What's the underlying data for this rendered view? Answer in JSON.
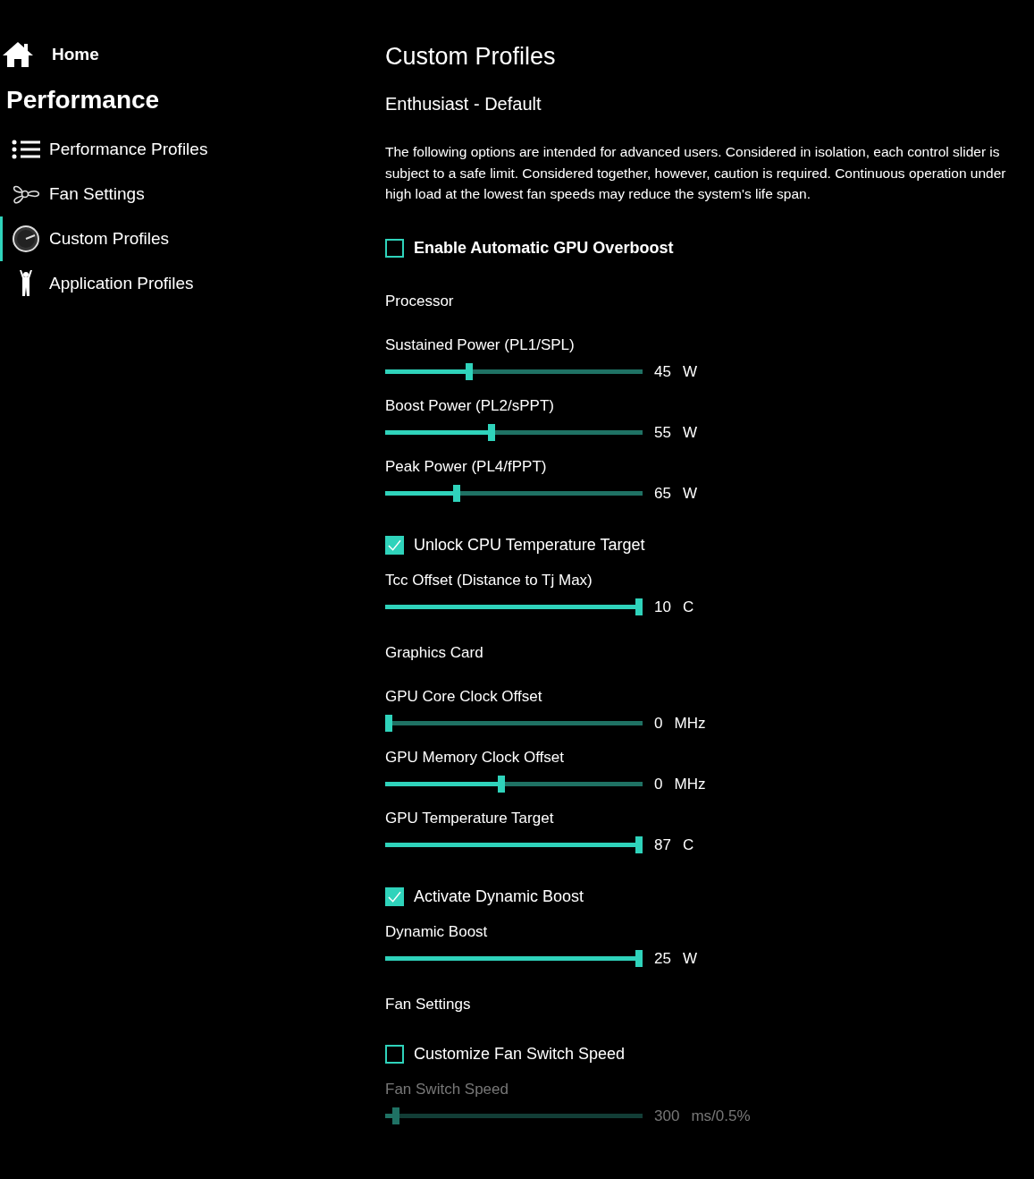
{
  "sidebar": {
    "home": "Home",
    "section": "Performance",
    "items": [
      {
        "label": "Performance Profiles",
        "selected": false
      },
      {
        "label": "Fan Settings",
        "selected": false
      },
      {
        "label": "Custom Profiles",
        "selected": true
      },
      {
        "label": "Application Profiles",
        "selected": false
      }
    ]
  },
  "main": {
    "title": "Custom Profiles",
    "subtitle": "Enthusiast - Default",
    "description": "The following options are intended for advanced users. Considered in isolation, each control slider is subject to a safe limit. Considered together, however, caution is required. Continuous operation under high load at the lowest fan speeds may reduce the system's life span.",
    "controls": [
      {
        "kind": "checkbox",
        "label": "Enable Automatic GPU Overboost",
        "checked": false,
        "bold": true
      },
      {
        "kind": "section",
        "label": "Processor"
      },
      {
        "kind": "slider",
        "label": "Sustained Power (PL1/SPL)",
        "level": 0.32,
        "value": "45",
        "unit": "W",
        "disabled": false
      },
      {
        "kind": "slider",
        "label": "Boost Power (PL2/sPPT)",
        "level": 0.41,
        "value": "55",
        "unit": "W",
        "disabled": false
      },
      {
        "kind": "slider",
        "label": "Peak Power (PL4/fPPT)",
        "level": 0.27,
        "value": "65",
        "unit": "W",
        "disabled": false
      },
      {
        "kind": "checkbox",
        "label": "Unlock CPU Temperature Target",
        "checked": true,
        "bold": false
      },
      {
        "kind": "slider",
        "label": "Tcc Offset (Distance to Tj Max)",
        "level": 1,
        "value": "10",
        "unit": "C",
        "disabled": false
      },
      {
        "kind": "section",
        "label": "Graphics Card"
      },
      {
        "kind": "slider",
        "label": "GPU Core Clock Offset",
        "level": 0,
        "value": "0",
        "unit": "MHz",
        "disabled": false
      },
      {
        "kind": "slider",
        "label": "GPU Memory Clock Offset",
        "level": 0.45,
        "value": "0",
        "unit": "MHz",
        "disabled": false
      },
      {
        "kind": "slider",
        "label": "GPU Temperature Target",
        "level": 1,
        "value": "87",
        "unit": "C",
        "disabled": false
      },
      {
        "kind": "checkbox",
        "label": "Activate Dynamic Boost",
        "checked": true,
        "bold": false
      },
      {
        "kind": "slider",
        "label": "Dynamic Boost",
        "level": 1,
        "value": "25",
        "unit": "W",
        "disabled": false
      },
      {
        "kind": "section",
        "label": "Fan Settings"
      },
      {
        "kind": "checkbox",
        "label": "Customize Fan Switch Speed",
        "checked": false,
        "bold": false
      },
      {
        "kind": "slider",
        "label": "Fan Switch Speed",
        "level": 0.03,
        "value": "300",
        "unit": "ms/0.5%",
        "disabled": true
      }
    ]
  }
}
